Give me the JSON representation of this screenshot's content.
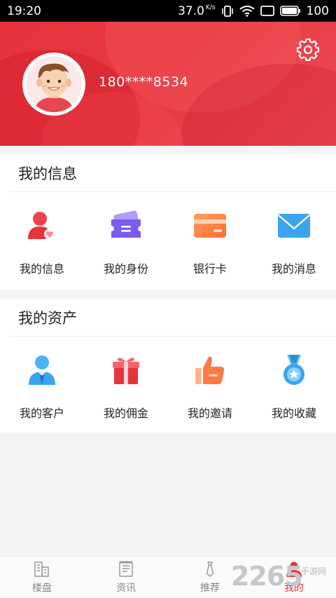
{
  "status_bar": {
    "time": "19:20",
    "speed": "37.0",
    "speed_unit": "K/s",
    "battery": "100"
  },
  "profile": {
    "phone": "180****8534"
  },
  "sections": [
    {
      "title": "我的信息",
      "items": [
        {
          "label": "我的信息",
          "icon": "person-heart-icon"
        },
        {
          "label": "我的身份",
          "icon": "id-ticket-icon"
        },
        {
          "label": "银行卡",
          "icon": "bank-card-icon"
        },
        {
          "label": "我的消息",
          "icon": "envelope-icon"
        }
      ]
    },
    {
      "title": "我的资产",
      "items": [
        {
          "label": "我的客户",
          "icon": "customer-icon"
        },
        {
          "label": "我的佣金",
          "icon": "gift-icon"
        },
        {
          "label": "我的邀请",
          "icon": "thumbs-up-icon"
        },
        {
          "label": "我的收藏",
          "icon": "medal-icon"
        }
      ]
    }
  ],
  "tabbar": [
    {
      "label": "楼盘",
      "icon": "building-icon"
    },
    {
      "label": "资讯",
      "icon": "news-icon"
    },
    {
      "label": "推荐",
      "icon": "tie-icon"
    },
    {
      "label": "我的",
      "icon": "user-icon",
      "active": true
    }
  ],
  "watermark": {
    "number": "2265",
    "site": "手游网"
  },
  "colors": {
    "brand_red": "#e8333d",
    "purple": "#7b5cf0",
    "orange": "#ff8040",
    "blue": "#3aa4ee"
  }
}
